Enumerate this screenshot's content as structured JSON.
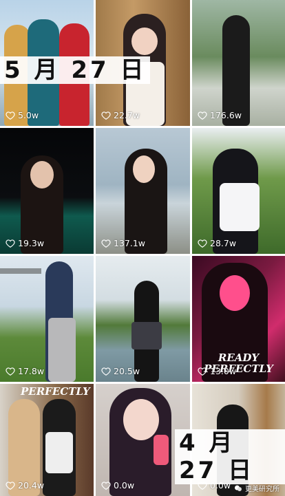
{
  "tiles": [
    {
      "likes": "5.0w"
    },
    {
      "likes": "22.7w"
    },
    {
      "likes": "176.6w"
    },
    {
      "likes": "19.3w"
    },
    {
      "likes": "137.1w"
    },
    {
      "likes": "28.7w"
    },
    {
      "likes": "17.8w"
    },
    {
      "likes": "20.5w"
    },
    {
      "likes": "13.0w"
    },
    {
      "likes": "20.4w"
    },
    {
      "likes": "0.0w"
    },
    {
      "likes": "0.0w"
    }
  ],
  "date_labels": {
    "first": "5 月 27 日",
    "second": "4 月 27 日"
  },
  "overlay": {
    "ready": "READY",
    "perfectly": "PERFECTLY",
    "perfectly2": "PERFECTLY"
  },
  "watermark": {
    "text": "更美研究所"
  }
}
